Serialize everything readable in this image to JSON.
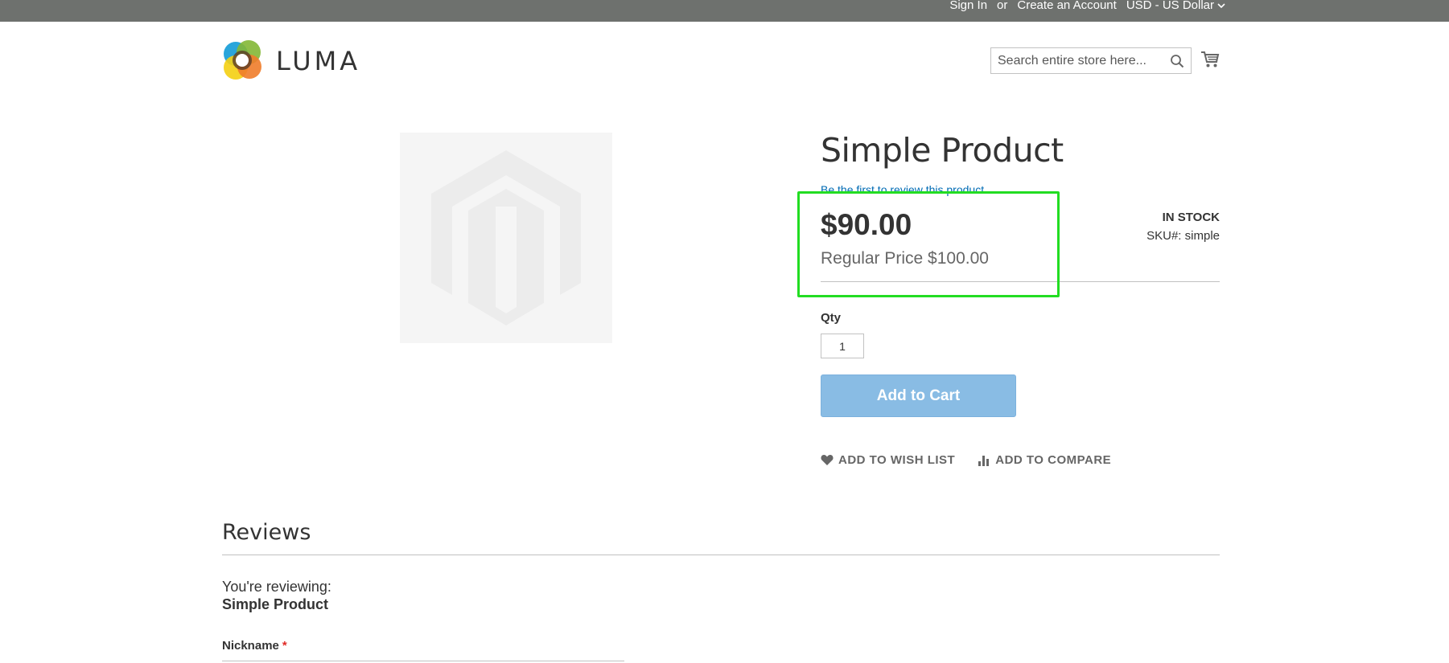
{
  "topbar": {
    "sign_in": "Sign In",
    "or": "or",
    "create_account": "Create an Account",
    "currency": "USD - US Dollar"
  },
  "header": {
    "logo_text": "LUMA",
    "search_placeholder": "Search entire store here..."
  },
  "product": {
    "title": "Simple Product",
    "review_link": "Be the first to review this product",
    "final_price": "$90.00",
    "old_price": "Regular Price $100.00",
    "stock": "IN STOCK",
    "sku": "SKU#:  simple",
    "qty_label": "Qty",
    "qty_value": "1",
    "add_to_cart": "Add to Cart",
    "wishlist": "ADD TO WISH LIST",
    "compare": "ADD TO COMPARE"
  },
  "reviews": {
    "title": "Reviews",
    "reviewing_label": "You're reviewing:",
    "reviewing_product": "Simple Product",
    "nickname_label": "Nickname",
    "required_mark": "*"
  },
  "colors": {
    "topbar": "#6e716e",
    "add_to_cart_bg": "#89bce4",
    "highlight": "#22dd22",
    "link": "#006bb4"
  }
}
